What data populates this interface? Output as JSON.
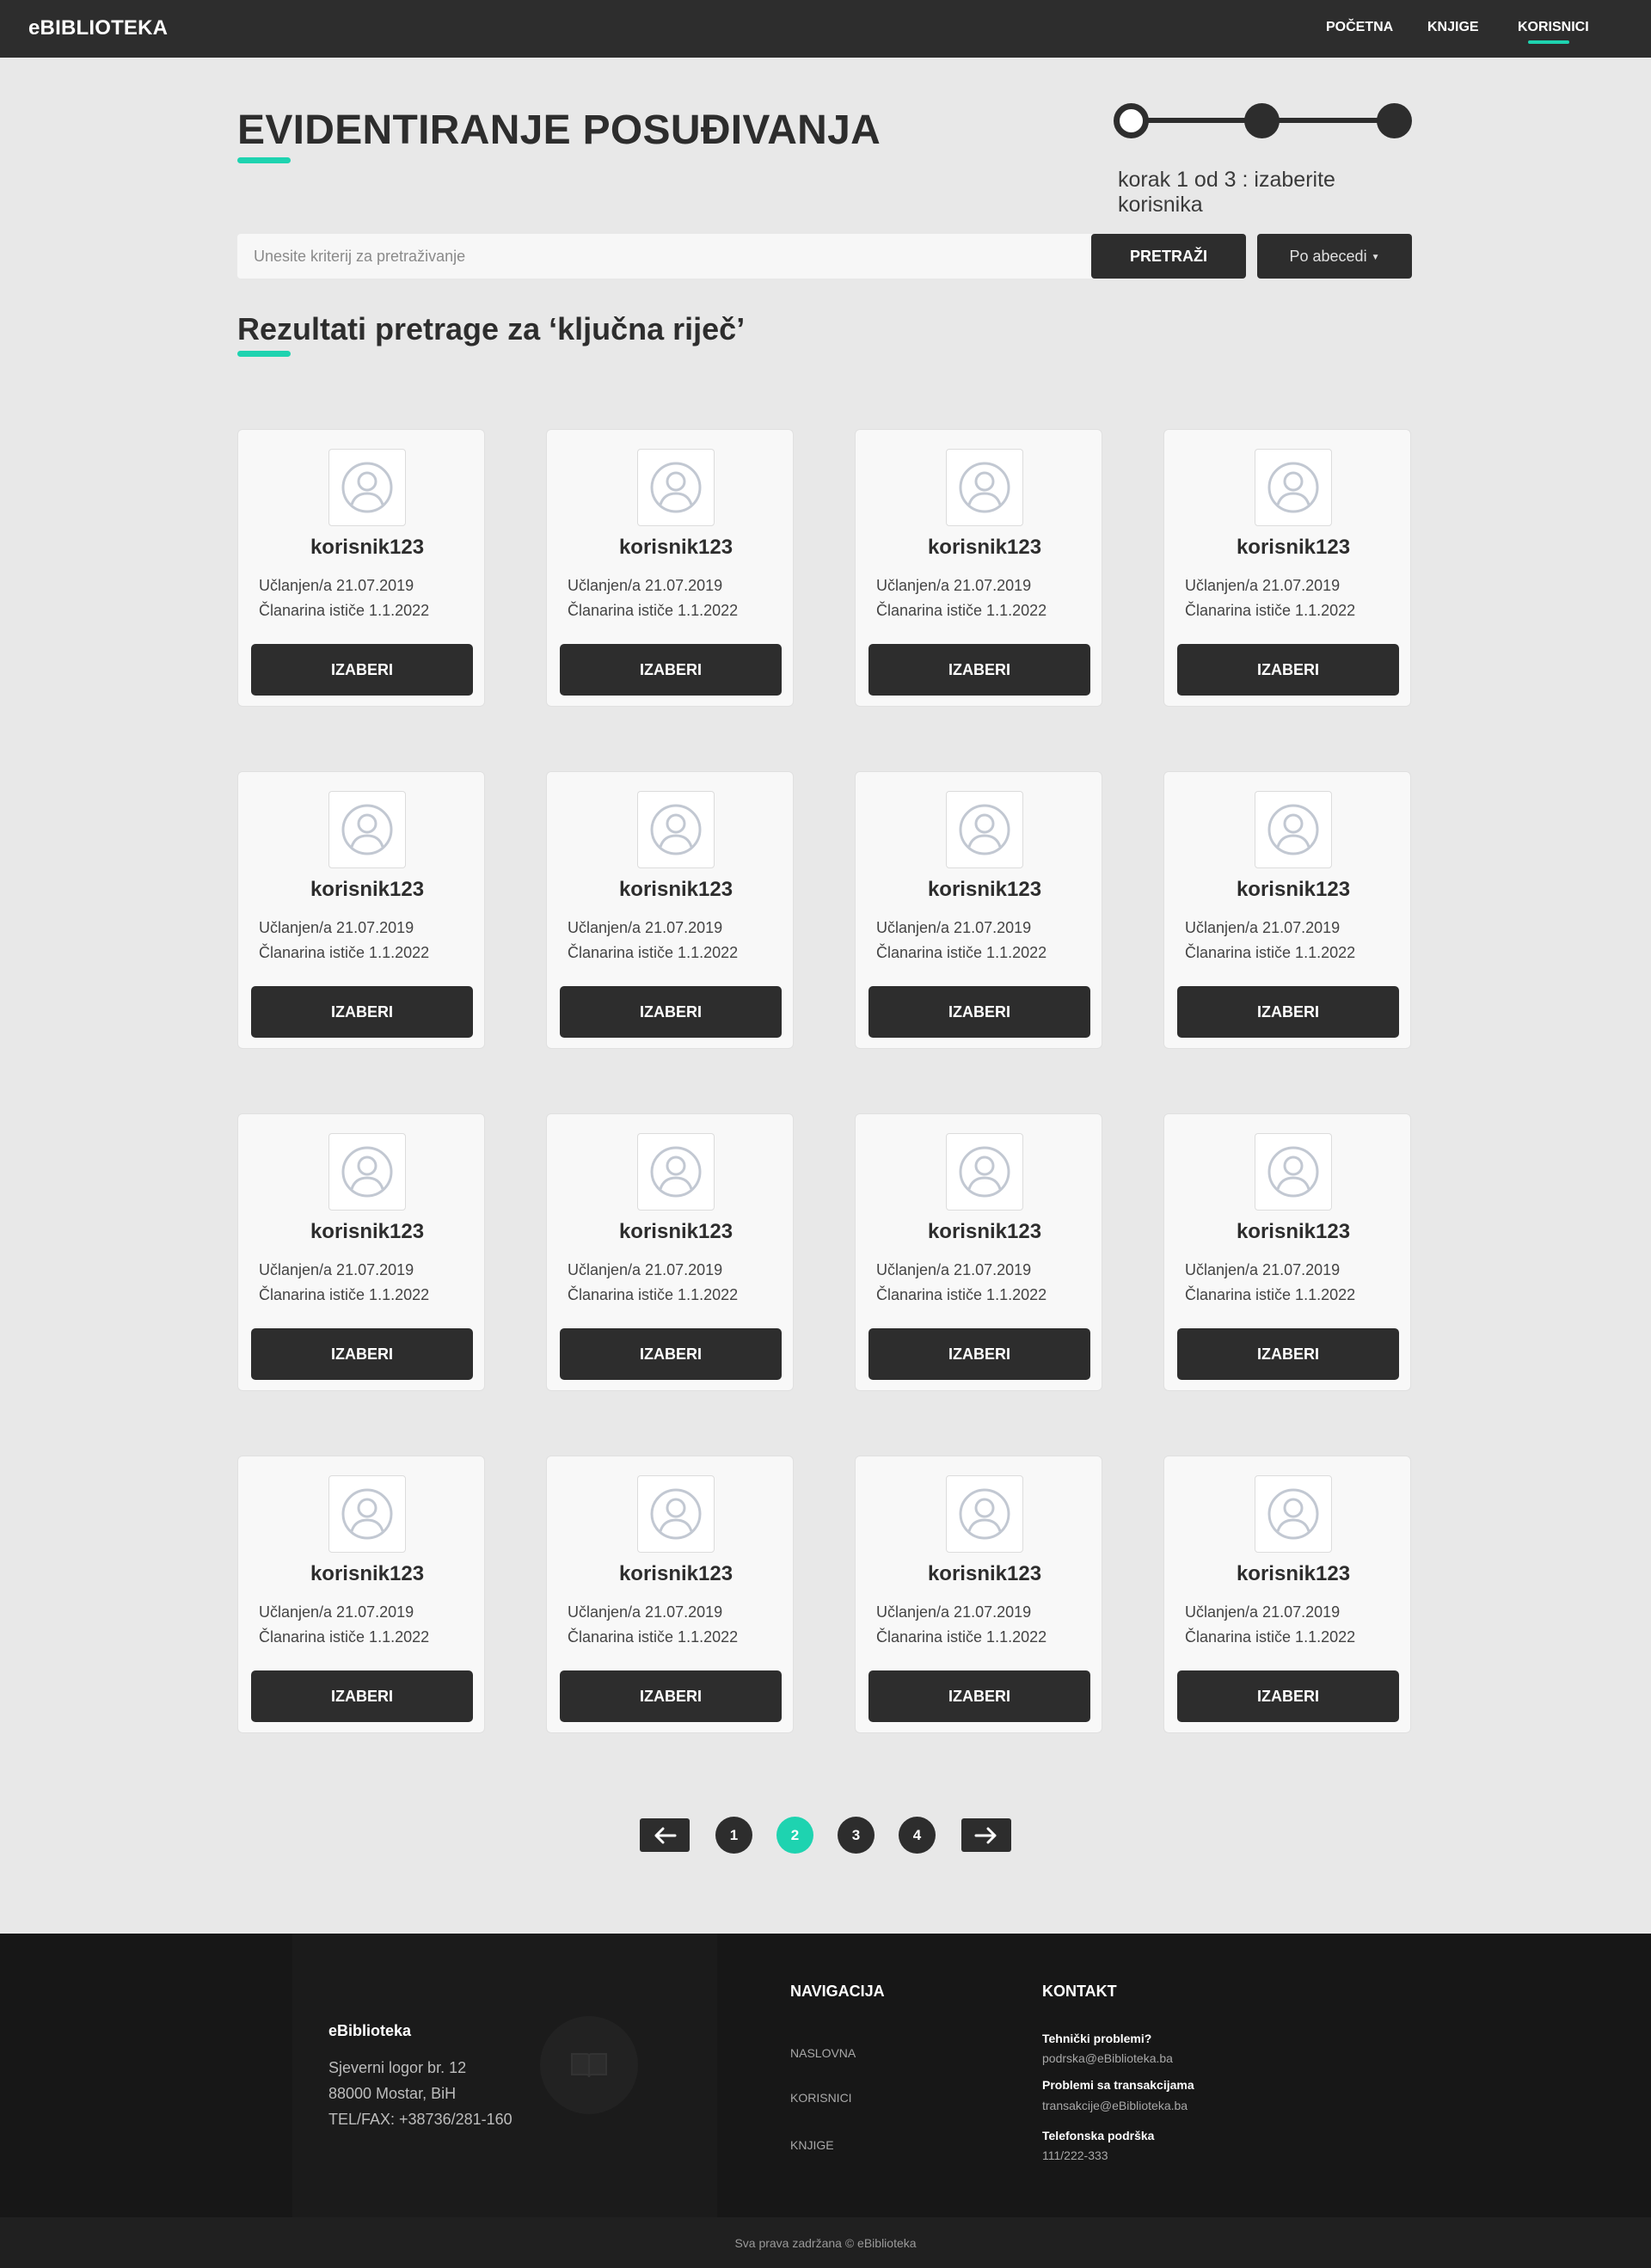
{
  "navbar": {
    "brand": "eBIBLIOTEKA",
    "links": [
      {
        "label": "POČETNA"
      },
      {
        "label": "KNJIGE"
      },
      {
        "label": "KORISNICI",
        "active": true
      }
    ],
    "accent_color": "#1ed3b0"
  },
  "header": {
    "title": "EVIDENTIRANJE POSUĐIVANJA",
    "stepper": {
      "current_step": 1,
      "total_steps": 3,
      "caption": "korak 1 od 3 : izaberite korisnika"
    }
  },
  "search": {
    "placeholder": "Unesite kriterij za pretraživanje",
    "value": "",
    "button_label": "PRETRAŽI",
    "sort_label": "Po abecedi"
  },
  "results": {
    "title": "Rezultati pretrage za ‘ključna riječ’",
    "cards": [
      {
        "username": "korisnik123",
        "member_since": "Učlanjen/a 21.07.2019",
        "expires": "Članarina ističe 1.1.2022",
        "button": "IZABERI"
      },
      {
        "username": "korisnik123",
        "member_since": "Učlanjen/a 21.07.2019",
        "expires": "Članarina ističe 1.1.2022",
        "button": "IZABERI"
      },
      {
        "username": "korisnik123",
        "member_since": "Učlanjen/a 21.07.2019",
        "expires": "Članarina ističe 1.1.2022",
        "button": "IZABERI"
      },
      {
        "username": "korisnik123",
        "member_since": "Učlanjen/a 21.07.2019",
        "expires": "Članarina ističe 1.1.2022",
        "button": "IZABERI"
      },
      {
        "username": "korisnik123",
        "member_since": "Učlanjen/a 21.07.2019",
        "expires": "Članarina ističe 1.1.2022",
        "button": "IZABERI"
      },
      {
        "username": "korisnik123",
        "member_since": "Učlanjen/a 21.07.2019",
        "expires": "Članarina ističe 1.1.2022",
        "button": "IZABERI"
      },
      {
        "username": "korisnik123",
        "member_since": "Učlanjen/a 21.07.2019",
        "expires": "Članarina ističe 1.1.2022",
        "button": "IZABERI"
      },
      {
        "username": "korisnik123",
        "member_since": "Učlanjen/a 21.07.2019",
        "expires": "Članarina ističe 1.1.2022",
        "button": "IZABERI"
      },
      {
        "username": "korisnik123",
        "member_since": "Učlanjen/a 21.07.2019",
        "expires": "Članarina ističe 1.1.2022",
        "button": "IZABERI"
      },
      {
        "username": "korisnik123",
        "member_since": "Učlanjen/a 21.07.2019",
        "expires": "Članarina ističe 1.1.2022",
        "button": "IZABERI"
      },
      {
        "username": "korisnik123",
        "member_since": "Učlanjen/a 21.07.2019",
        "expires": "Članarina ističe 1.1.2022",
        "button": "IZABERI"
      },
      {
        "username": "korisnik123",
        "member_since": "Učlanjen/a 21.07.2019",
        "expires": "Članarina ističe 1.1.2022",
        "button": "IZABERI"
      },
      {
        "username": "korisnik123",
        "member_since": "Učlanjen/a 21.07.2019",
        "expires": "Članarina ističe 1.1.2022",
        "button": "IZABERI"
      },
      {
        "username": "korisnik123",
        "member_since": "Učlanjen/a 21.07.2019",
        "expires": "Članarina ističe 1.1.2022",
        "button": "IZABERI"
      },
      {
        "username": "korisnik123",
        "member_since": "Učlanjen/a 21.07.2019",
        "expires": "Članarina ističe 1.1.2022",
        "button": "IZABERI"
      },
      {
        "username": "korisnik123",
        "member_since": "Učlanjen/a 21.07.2019",
        "expires": "Članarina ističe 1.1.2022",
        "button": "IZABERI"
      }
    ]
  },
  "pagination": {
    "pages": [
      "1",
      "2",
      "3",
      "4"
    ],
    "current_page": "2"
  },
  "footer": {
    "name": "eBiblioteka",
    "address": [
      "Sjeverni logor br. 12",
      "88000 Mostar, BiH",
      "TEL/FAX: +38736/281-160"
    ],
    "nav_heading": "NAVIGACIJA",
    "nav_links": [
      "NASLOVNA",
      "KORISNICI",
      "KNJIGE"
    ],
    "contact_heading": "KONTAKT",
    "contacts": [
      {
        "label": "Tehnički problemi?",
        "value": "podrska@eBiblioteka.ba"
      },
      {
        "label": "Problemi sa transakcijama",
        "value": "transakcije@eBiblioteka.ba"
      },
      {
        "label": "Telefonska podrška",
        "value": "111/222-333"
      }
    ],
    "copyright": "Sva prava zadržana © eBiblioteka"
  }
}
